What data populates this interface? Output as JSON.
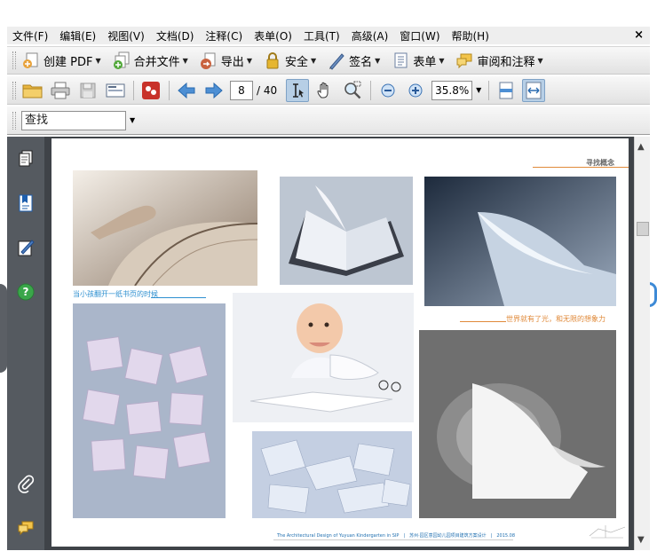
{
  "menu": {
    "items": [
      "文件(F)",
      "编辑(E)",
      "视图(V)",
      "文档(D)",
      "注释(C)",
      "表单(O)",
      "工具(T)",
      "高级(A)",
      "窗口(W)",
      "帮助(H)"
    ],
    "close_label": "×"
  },
  "toolbar1": {
    "create_pdf": "创建 PDF",
    "combine": "合并文件",
    "export": "导出",
    "security": "安全",
    "sign": "签名",
    "forms": "表单",
    "review": "审阅和注释"
  },
  "toolbar2": {
    "page_current": "8",
    "page_total": "/ 40",
    "zoom": "35.8%"
  },
  "find": {
    "value": "查找"
  },
  "doc_page": {
    "heading": "寻找概念",
    "caption_blue": "当小孩翻开一纸书页的时候",
    "caption_orange": "世界就有了光，和无限的想象力",
    "footer": "The Architectural Design of Yuyuan Kindergarten in SIP　|　苏州·园区意园幼儿园项目建筑方案设计　|　2015.08"
  },
  "colors": {
    "accent_blue": "#2d8fd0",
    "accent_orange": "#e08a3a",
    "panel_dark": "#555a60",
    "doc_bg": "#3f4348"
  }
}
